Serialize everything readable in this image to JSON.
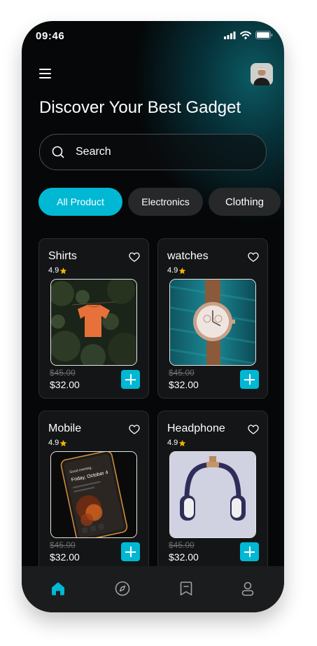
{
  "status_bar": {
    "time": "09:46"
  },
  "header": {
    "title": "Discover Your Best Gadget"
  },
  "search": {
    "label": "Search"
  },
  "categories": [
    {
      "label": "All Product",
      "active": true
    },
    {
      "label": "Electronics",
      "active": false
    },
    {
      "label": "Clothing",
      "active": false
    }
  ],
  "products": [
    {
      "name": "Shirts",
      "rating": "4.9",
      "old_price": "$45.00",
      "price": "$32.00"
    },
    {
      "name": "watches",
      "rating": "4.9",
      "old_price": "$45.00",
      "price": "$32.00"
    },
    {
      "name": "Mobile",
      "rating": "4.9",
      "old_price": "$45.00",
      "price": "$32.00"
    },
    {
      "name": "Headphone",
      "rating": "4.9",
      "old_price": "$45.00",
      "price": "$32.00"
    }
  ],
  "mobile_screen": {
    "line1": "Good evening,",
    "line2": "Friday, October 4"
  },
  "bottom_nav": [
    "home-icon",
    "compass-icon",
    "bookmark-icon",
    "profile-icon"
  ],
  "colors": {
    "accent": "#00b8d4",
    "background": "#050708",
    "card": "#131516",
    "star": "#f5b400"
  }
}
